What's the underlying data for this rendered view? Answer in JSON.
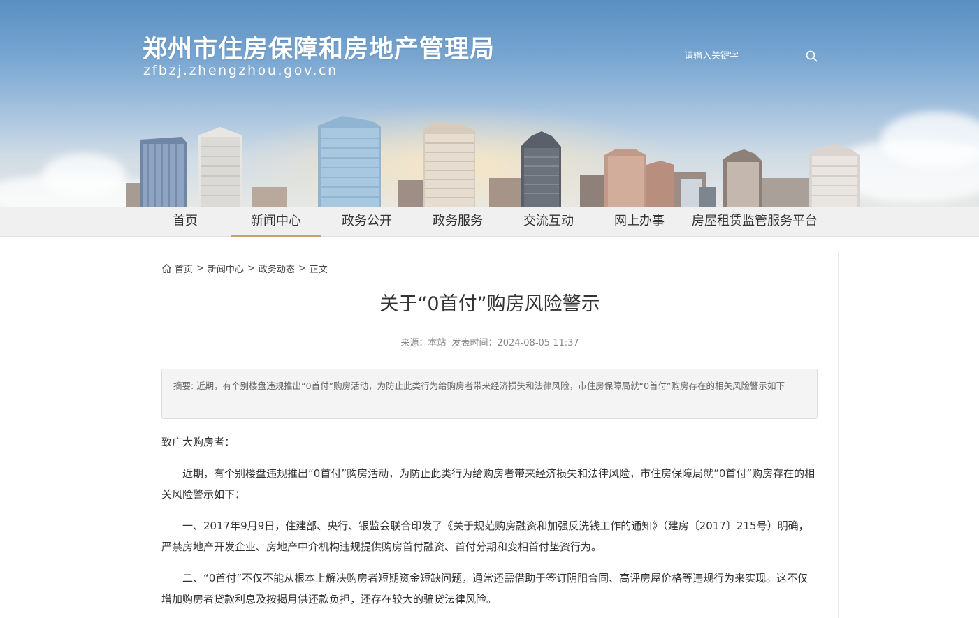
{
  "header": {
    "site_title": "郑州市住房保障和房地产管理局",
    "site_domain": "zfbzj.zhengzhou.gov.cn",
    "search_placeholder": "请输入关键字"
  },
  "nav": {
    "items": [
      {
        "label": "首页"
      },
      {
        "label": "新闻中心"
      },
      {
        "label": "政务公开"
      },
      {
        "label": "政务服务"
      },
      {
        "label": "交流互动"
      },
      {
        "label": "网上办事"
      },
      {
        "label": "房屋租赁监管服务平台"
      }
    ],
    "active_index": 1
  },
  "breadcrumb": {
    "home": "首页",
    "level1": "新闻中心",
    "level2": "政务动态",
    "current": "正文",
    "separator": ">"
  },
  "article": {
    "title": "关于“0首付”购房风险警示",
    "source_label": "来源：本站",
    "publish_label": "发表时间：2024-08-05 11:37",
    "summary": "摘要: 近期，有个别楼盘违规推出“0首付”购房活动，为防止此类行为给购房者带来经济损失和法律风险，市住房保障局就“0首付”购房存在的相关风险警示如下",
    "paragraphs": [
      "致广大购房者：",
      "近期，有个别楼盘违规推出“0首付”购房活动，为防止此类行为给购房者带来经济损失和法律风险，市住房保障局就“0首付”购房存在的相关风险警示如下：",
      "一、2017年9月9日，住建部、央行、银监会联合印发了《关于规范购房融资和加强反洗钱工作的通知》（建房〔2017〕215号）明确，严禁房地产开发企业、房地产中介机构违规提供购房首付融资、首付分期和变相首付垫资行为。",
      "二、“0首付”不仅不能从根本上解决购房者短期资金短缺问题，通常还需借助于签订阴阳合同、高评房屋价格等违规行为来实现。这不仅增加购房者贷款利息及按揭月供还款负担，还存在较大的骗贷法律风险。"
    ]
  },
  "colors": {
    "nav_active_underline": "#c8a16b",
    "nav_background": "#f0f0f0"
  },
  "icons": {
    "search": "search-icon",
    "home": "home-icon"
  }
}
